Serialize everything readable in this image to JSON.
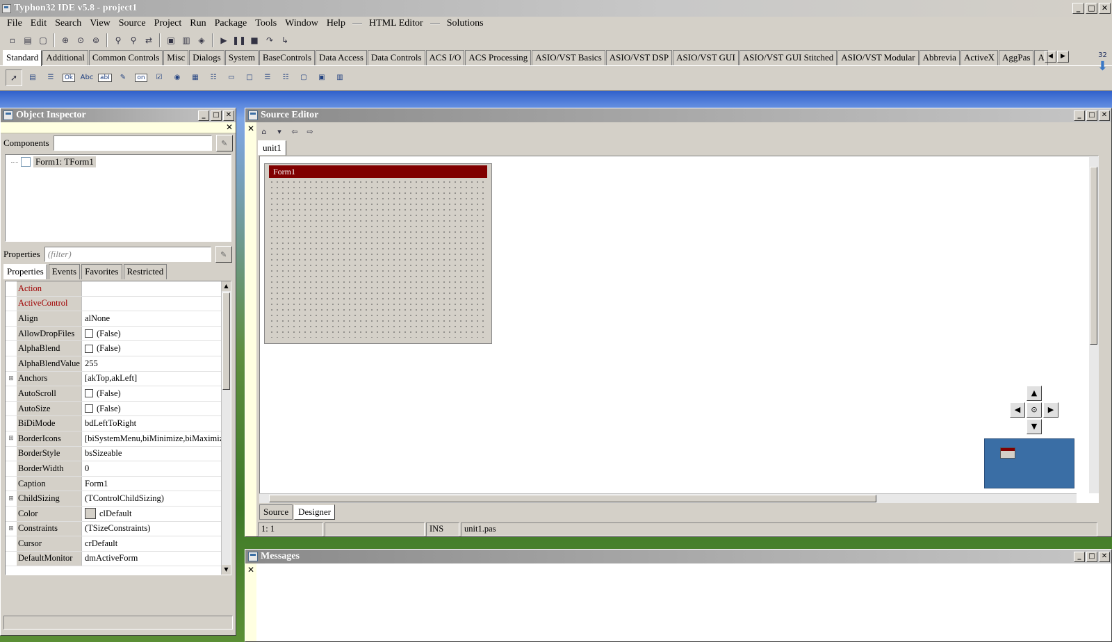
{
  "window": {
    "title": "Typhon32 IDE v5.8 - project1",
    "controls": [
      "_",
      "□",
      "✕"
    ]
  },
  "menu": {
    "items": [
      "File",
      "Edit",
      "Search",
      "View",
      "Source",
      "Project",
      "Run",
      "Package",
      "Tools",
      "Window",
      "Help"
    ],
    "extras": [
      "HTML Editor",
      "Solutions"
    ]
  },
  "toolbar": {
    "icons": [
      "new-unit-icon",
      "new-form-icon",
      "new-icon",
      "open-icon",
      "save-icon",
      "save-all-icon",
      "find-icon",
      "find-next-icon",
      "replace-icon",
      "view-units-icon",
      "view-forms-icon",
      "toggle-icon",
      "run-icon",
      "pause-icon",
      "stop-icon",
      "step-over-icon",
      "step-into-icon"
    ]
  },
  "palette": {
    "tabs": [
      "Standard",
      "Additional",
      "Common Controls",
      "Misc",
      "Dialogs",
      "System",
      "BaseControls",
      "Data Access",
      "Data Controls",
      "ACS I/O",
      "ACS Processing",
      "ASIO/VST Basics",
      "ASIO/VST DSP",
      "ASIO/VST GUI",
      "ASIO/VST GUI Stitched",
      "ASIO/VST Modular",
      "Abbrevia",
      "ActiveX",
      "AggPas",
      "A"
    ],
    "active_tab": "Standard",
    "components": [
      {
        "name": "main-menu-icon",
        "glyph": "▤"
      },
      {
        "name": "popup-menu-icon",
        "glyph": "☰"
      },
      {
        "name": "button-icon",
        "glyph": "Ok"
      },
      {
        "name": "label-icon",
        "glyph": "Abc"
      },
      {
        "name": "edit-icon",
        "glyph": "abI"
      },
      {
        "name": "memo-icon",
        "glyph": "✎"
      },
      {
        "name": "toggle-box-icon",
        "glyph": "on"
      },
      {
        "name": "checkbox-icon",
        "glyph": "☑"
      },
      {
        "name": "radio-button-icon",
        "glyph": "◉"
      },
      {
        "name": "listbox-icon",
        "glyph": "▦"
      },
      {
        "name": "combobox-icon",
        "glyph": "☷"
      },
      {
        "name": "scrollbar-icon",
        "glyph": "▭"
      },
      {
        "name": "groupbox-icon",
        "glyph": "□"
      },
      {
        "name": "radiogroup-icon",
        "glyph": "☰"
      },
      {
        "name": "checkgroup-icon",
        "glyph": "☷"
      },
      {
        "name": "panel-icon",
        "glyph": "▢"
      },
      {
        "name": "frame-icon",
        "glyph": "▣"
      },
      {
        "name": "actionlist-icon",
        "glyph": "▥"
      }
    ],
    "counter": "32"
  },
  "object_inspector": {
    "title": "Object Inspector",
    "components_label": "Components",
    "components_value": "",
    "tree_item": "Form1: TForm1",
    "properties_label": "Properties",
    "filter_placeholder": "(filter)",
    "tabs": [
      "Properties",
      "Events",
      "Favorites",
      "Restricted"
    ],
    "active_tab": "Properties",
    "rows": [
      {
        "name": "Action",
        "value": "",
        "red": true,
        "expand": false,
        "kind": "text"
      },
      {
        "name": "ActiveControl",
        "value": "",
        "red": true,
        "expand": false,
        "kind": "text"
      },
      {
        "name": "Align",
        "value": "alNone",
        "red": false,
        "expand": false,
        "kind": "text"
      },
      {
        "name": "AllowDropFiles",
        "value": "(False)",
        "red": false,
        "expand": false,
        "kind": "check"
      },
      {
        "name": "AlphaBlend",
        "value": "(False)",
        "red": false,
        "expand": false,
        "kind": "check"
      },
      {
        "name": "AlphaBlendValue",
        "value": "255",
        "red": false,
        "expand": false,
        "kind": "text"
      },
      {
        "name": "Anchors",
        "value": "[akTop,akLeft]",
        "red": false,
        "expand": true,
        "kind": "text"
      },
      {
        "name": "AutoScroll",
        "value": "(False)",
        "red": false,
        "expand": false,
        "kind": "check"
      },
      {
        "name": "AutoSize",
        "value": "(False)",
        "red": false,
        "expand": false,
        "kind": "check"
      },
      {
        "name": "BiDiMode",
        "value": "bdLeftToRight",
        "red": false,
        "expand": false,
        "kind": "text"
      },
      {
        "name": "BorderIcons",
        "value": "[biSystemMenu,biMinimize,biMaximiz",
        "red": false,
        "expand": true,
        "kind": "text"
      },
      {
        "name": "BorderStyle",
        "value": "bsSizeable",
        "red": false,
        "expand": false,
        "kind": "text"
      },
      {
        "name": "BorderWidth",
        "value": "0",
        "red": false,
        "expand": false,
        "kind": "text"
      },
      {
        "name": "Caption",
        "value": "Form1",
        "red": false,
        "expand": false,
        "kind": "text"
      },
      {
        "name": "ChildSizing",
        "value": "(TControlChildSizing)",
        "red": false,
        "expand": true,
        "kind": "text"
      },
      {
        "name": "Color",
        "value": "clDefault",
        "red": false,
        "expand": false,
        "kind": "color"
      },
      {
        "name": "Constraints",
        "value": "(TSizeConstraints)",
        "red": false,
        "expand": true,
        "kind": "text"
      },
      {
        "name": "Cursor",
        "value": "crDefault",
        "red": false,
        "expand": false,
        "kind": "text"
      },
      {
        "name": "DefaultMonitor",
        "value": "dmActiveForm",
        "red": false,
        "expand": false,
        "kind": "text"
      }
    ]
  },
  "source_editor": {
    "title": "Source Editor",
    "file_tab": "unit1",
    "form_caption": "Form1",
    "bottom_tabs": [
      "Source",
      "Designer"
    ],
    "active_bottom_tab": "Designer",
    "status": {
      "position": "1:  1",
      "mode": "INS",
      "file": "unit1.pas"
    },
    "nav_center": "⊙"
  },
  "messages": {
    "title": "Messages"
  },
  "colors": {
    "form_caption_bg": "#800000",
    "hint_yellow": "#ffffe1",
    "minimap_bg": "#3a6ea5",
    "property_red": "#a00000"
  }
}
